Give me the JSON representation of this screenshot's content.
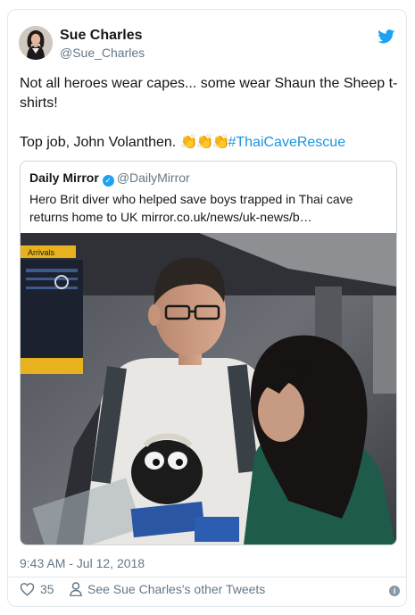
{
  "tweet": {
    "author_name": "Sue Charles",
    "author_handle": "@Sue_Charles",
    "text_line1": "Not all heroes wear capes... some wear Shaun the Sheep t-shirts!",
    "text_line2_prefix": "Top job, John Volanthen. ",
    "claps": "👏👏👏",
    "hashtag": "#ThaiCaveRescue",
    "timestamp": "9:43 AM - Jul 12, 2018",
    "like_count": "35",
    "other_tweets_label": "See Sue Charles's other Tweets"
  },
  "quoted": {
    "source_name": "Daily Mirror",
    "source_handle": "@DailyMirror",
    "text": "Hero Brit diver who helped save boys trapped in Thai cave returns home to UK mirror.co.uk/news/uk-news/b…",
    "photo_signs": {
      "arrivals": "Arrivals"
    }
  },
  "icons": {
    "brand": "twitter-bird-icon",
    "verified": "verified-badge-icon",
    "like": "heart-icon",
    "person": "person-icon",
    "info": "info-icon"
  },
  "colors": {
    "link": "#1b95e0",
    "muted": "#657786",
    "border": "#e1e8ed",
    "brand": "#1da1f2"
  }
}
